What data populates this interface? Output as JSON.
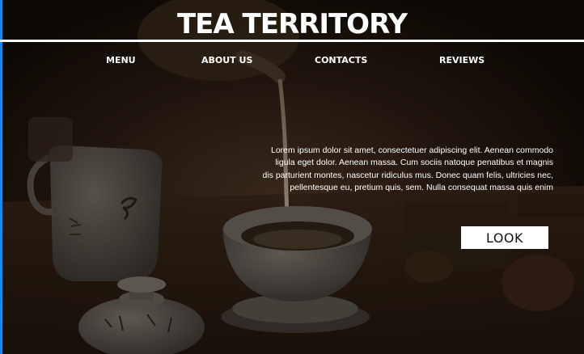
{
  "header": {
    "title": "TEA TERRITORY"
  },
  "nav": {
    "items": [
      {
        "label": "MENU"
      },
      {
        "label": "ABOUT US"
      },
      {
        "label": "CONTACTS"
      },
      {
        "label": "REVIEWS"
      }
    ]
  },
  "hero": {
    "intro": "Lorem ipsum dolor sit amet, consectetuer adipiscing elit. Aenean commodo ligula eget dolor. Aenean massa. Cum sociis natoque penatibus et magnis dis parturient montes, nascetur ridiculus mus. Donec quam felis, ultricies nec, pellentesque eu, pretium quis, sem. Nulla consequat massa quis enim",
    "button_label": "LOOK"
  },
  "colors": {
    "accent_edge": "#1e88e5",
    "text": "#ffffff",
    "button_bg": "#ffffff"
  }
}
